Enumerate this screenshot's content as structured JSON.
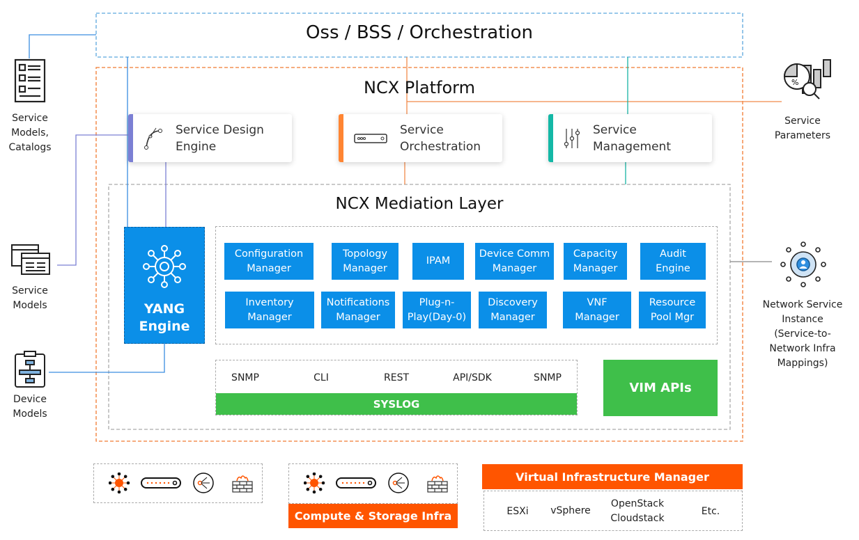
{
  "top": {
    "title": "Oss / BSS / Orchestration"
  },
  "platform": {
    "title": "NCX Platform"
  },
  "engines": [
    {
      "label_1": "Service Design",
      "label_2": "Engine",
      "icon": "bezier-curve-icon",
      "color": "#7b7fd4"
    },
    {
      "label_1": "Service",
      "label_2": "Orchestration",
      "icon": "server-icon",
      "color": "#ff8533"
    },
    {
      "label_1": "Service",
      "label_2": "Management",
      "icon": "sliders-icon",
      "color": "#14b8a6"
    }
  ],
  "mediation": {
    "title": "NCX Mediation Layer",
    "yang": {
      "line_1": "YANG",
      "line_2": "Engine"
    },
    "modules_row1": [
      {
        "l1": "Configuration",
        "l2": "Manager"
      },
      {
        "l1": "Topology",
        "l2": "Manager"
      },
      {
        "l1": "IPAM",
        "l2": ""
      },
      {
        "l1": "Device Comm",
        "l2": "Manager"
      },
      {
        "l1": "Capacity",
        "l2": "Manager"
      },
      {
        "l1": "Audit",
        "l2": "Engine"
      }
    ],
    "modules_row2": [
      {
        "l1": "Inventory",
        "l2": "Manager"
      },
      {
        "l1": "Notifications",
        "l2": "Manager"
      },
      {
        "l1": "Plug-n-",
        "l2": "Play(Day-0)"
      },
      {
        "l1": "Discovery",
        "l2": "Manager"
      },
      {
        "l1": "VNF",
        "l2": "Manager"
      },
      {
        "l1": "Resource",
        "l2": "Pool Mgr"
      }
    ],
    "protocols": [
      "SNMP",
      "CLI",
      "REST",
      "API/SDK",
      "SNMP"
    ],
    "syslog": "SYSLOG",
    "vim_apis": "VIM APIs"
  },
  "left": [
    {
      "l1": "Service",
      "l2": "Models,",
      "l3": "Catalogs"
    },
    {
      "l1": "Service",
      "l2": "Models"
    },
    {
      "l1": "Device",
      "l2": "Models"
    }
  ],
  "right": {
    "params": {
      "l1": "Service",
      "l2": "Parameters"
    },
    "instance": {
      "l1": "Network Service",
      "l2": "Instance",
      "l3": "(Service-to-",
      "l4": "Network Infra",
      "l5": "Mappings)"
    }
  },
  "bottom": {
    "compute_label": "Compute & Storage Infra",
    "vim_label": "Virtual Infrastructure Manager",
    "vim_items": [
      "ESXi",
      "vSphere",
      "OpenStack",
      "Cloudstack",
      "Etc."
    ]
  },
  "colors": {
    "module_blue": "#0b8fe8",
    "green": "#3fbf4a",
    "orange": "#ff5500"
  }
}
